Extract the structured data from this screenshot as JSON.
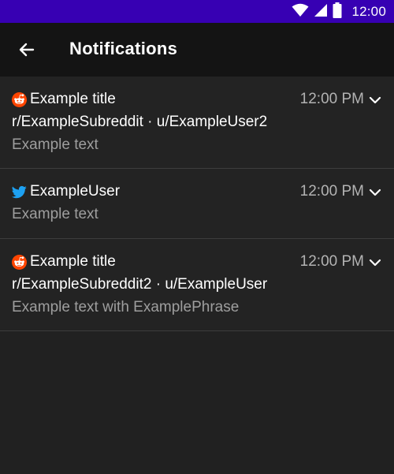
{
  "status_bar": {
    "time": "12:00",
    "icons": [
      "wifi-icon",
      "signal-icon",
      "battery-icon"
    ],
    "color": "#3700b3"
  },
  "app_bar": {
    "back_icon": "arrow-left-icon",
    "title": "Notifications"
  },
  "notifications": [
    {
      "app": "reddit",
      "icon": "reddit-icon",
      "title": "Example title",
      "time": "12:00 PM",
      "subtitle": "r/ExampleSubreddit · u/ExampleUser2",
      "text": "Example text"
    },
    {
      "app": "twitter",
      "icon": "twitter-icon",
      "title": "ExampleUser",
      "time": "12:00 PM",
      "text": "Example text"
    },
    {
      "app": "reddit",
      "icon": "reddit-icon",
      "title": "Example title",
      "time": "12:00 PM",
      "subtitle": "r/ExampleSubreddit2 · u/ExampleUser",
      "text": "Example text with ExamplePhrase"
    }
  ],
  "colors": {
    "reddit": "#ff4500",
    "twitter": "#1da1f2",
    "background": "#212121"
  }
}
